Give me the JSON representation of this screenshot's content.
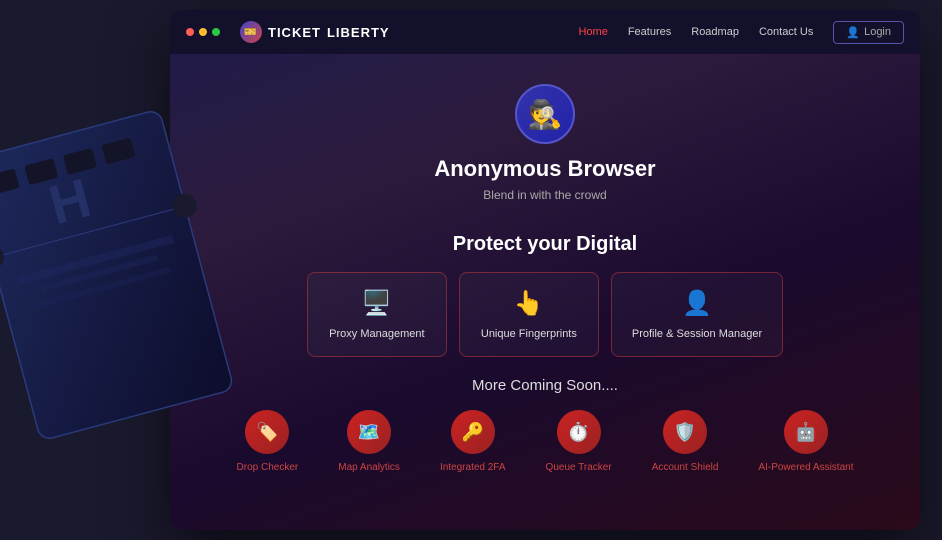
{
  "browser": {
    "logo_text_left": "TICKET",
    "logo_text_right": "LIBERTY",
    "nav": {
      "links": [
        {
          "label": "Home",
          "active": true
        },
        {
          "label": "Features",
          "active": false
        },
        {
          "label": "Roadmap",
          "active": false
        },
        {
          "label": "Contact Us",
          "active": false
        }
      ],
      "login_label": "Login"
    }
  },
  "hero": {
    "icon": "🕵️",
    "title": "Anonymous Browser",
    "subtitle": "Blend in with the crowd",
    "section_heading": "Protect your Digital"
  },
  "feature_cards": [
    {
      "icon": "🖥️",
      "label": "Proxy Management"
    },
    {
      "icon": "👆",
      "label": "Unique Fingerprints"
    },
    {
      "icon": "👤",
      "label": "Profile & Session Manager"
    }
  ],
  "coming_soon": {
    "title": "More Coming Soon....",
    "items": [
      {
        "icon": "🏷️",
        "label": "Drop Checker"
      },
      {
        "icon": "🗺️",
        "label": "Map Analytics"
      },
      {
        "icon": "🔑",
        "label": "Integrated 2FA"
      },
      {
        "icon": "⏱️",
        "label": "Queue Tracker"
      },
      {
        "icon": "🛡️",
        "label": "Account Shield"
      },
      {
        "icon": "🤖",
        "label": "AI-Powered Assistant"
      }
    ]
  }
}
